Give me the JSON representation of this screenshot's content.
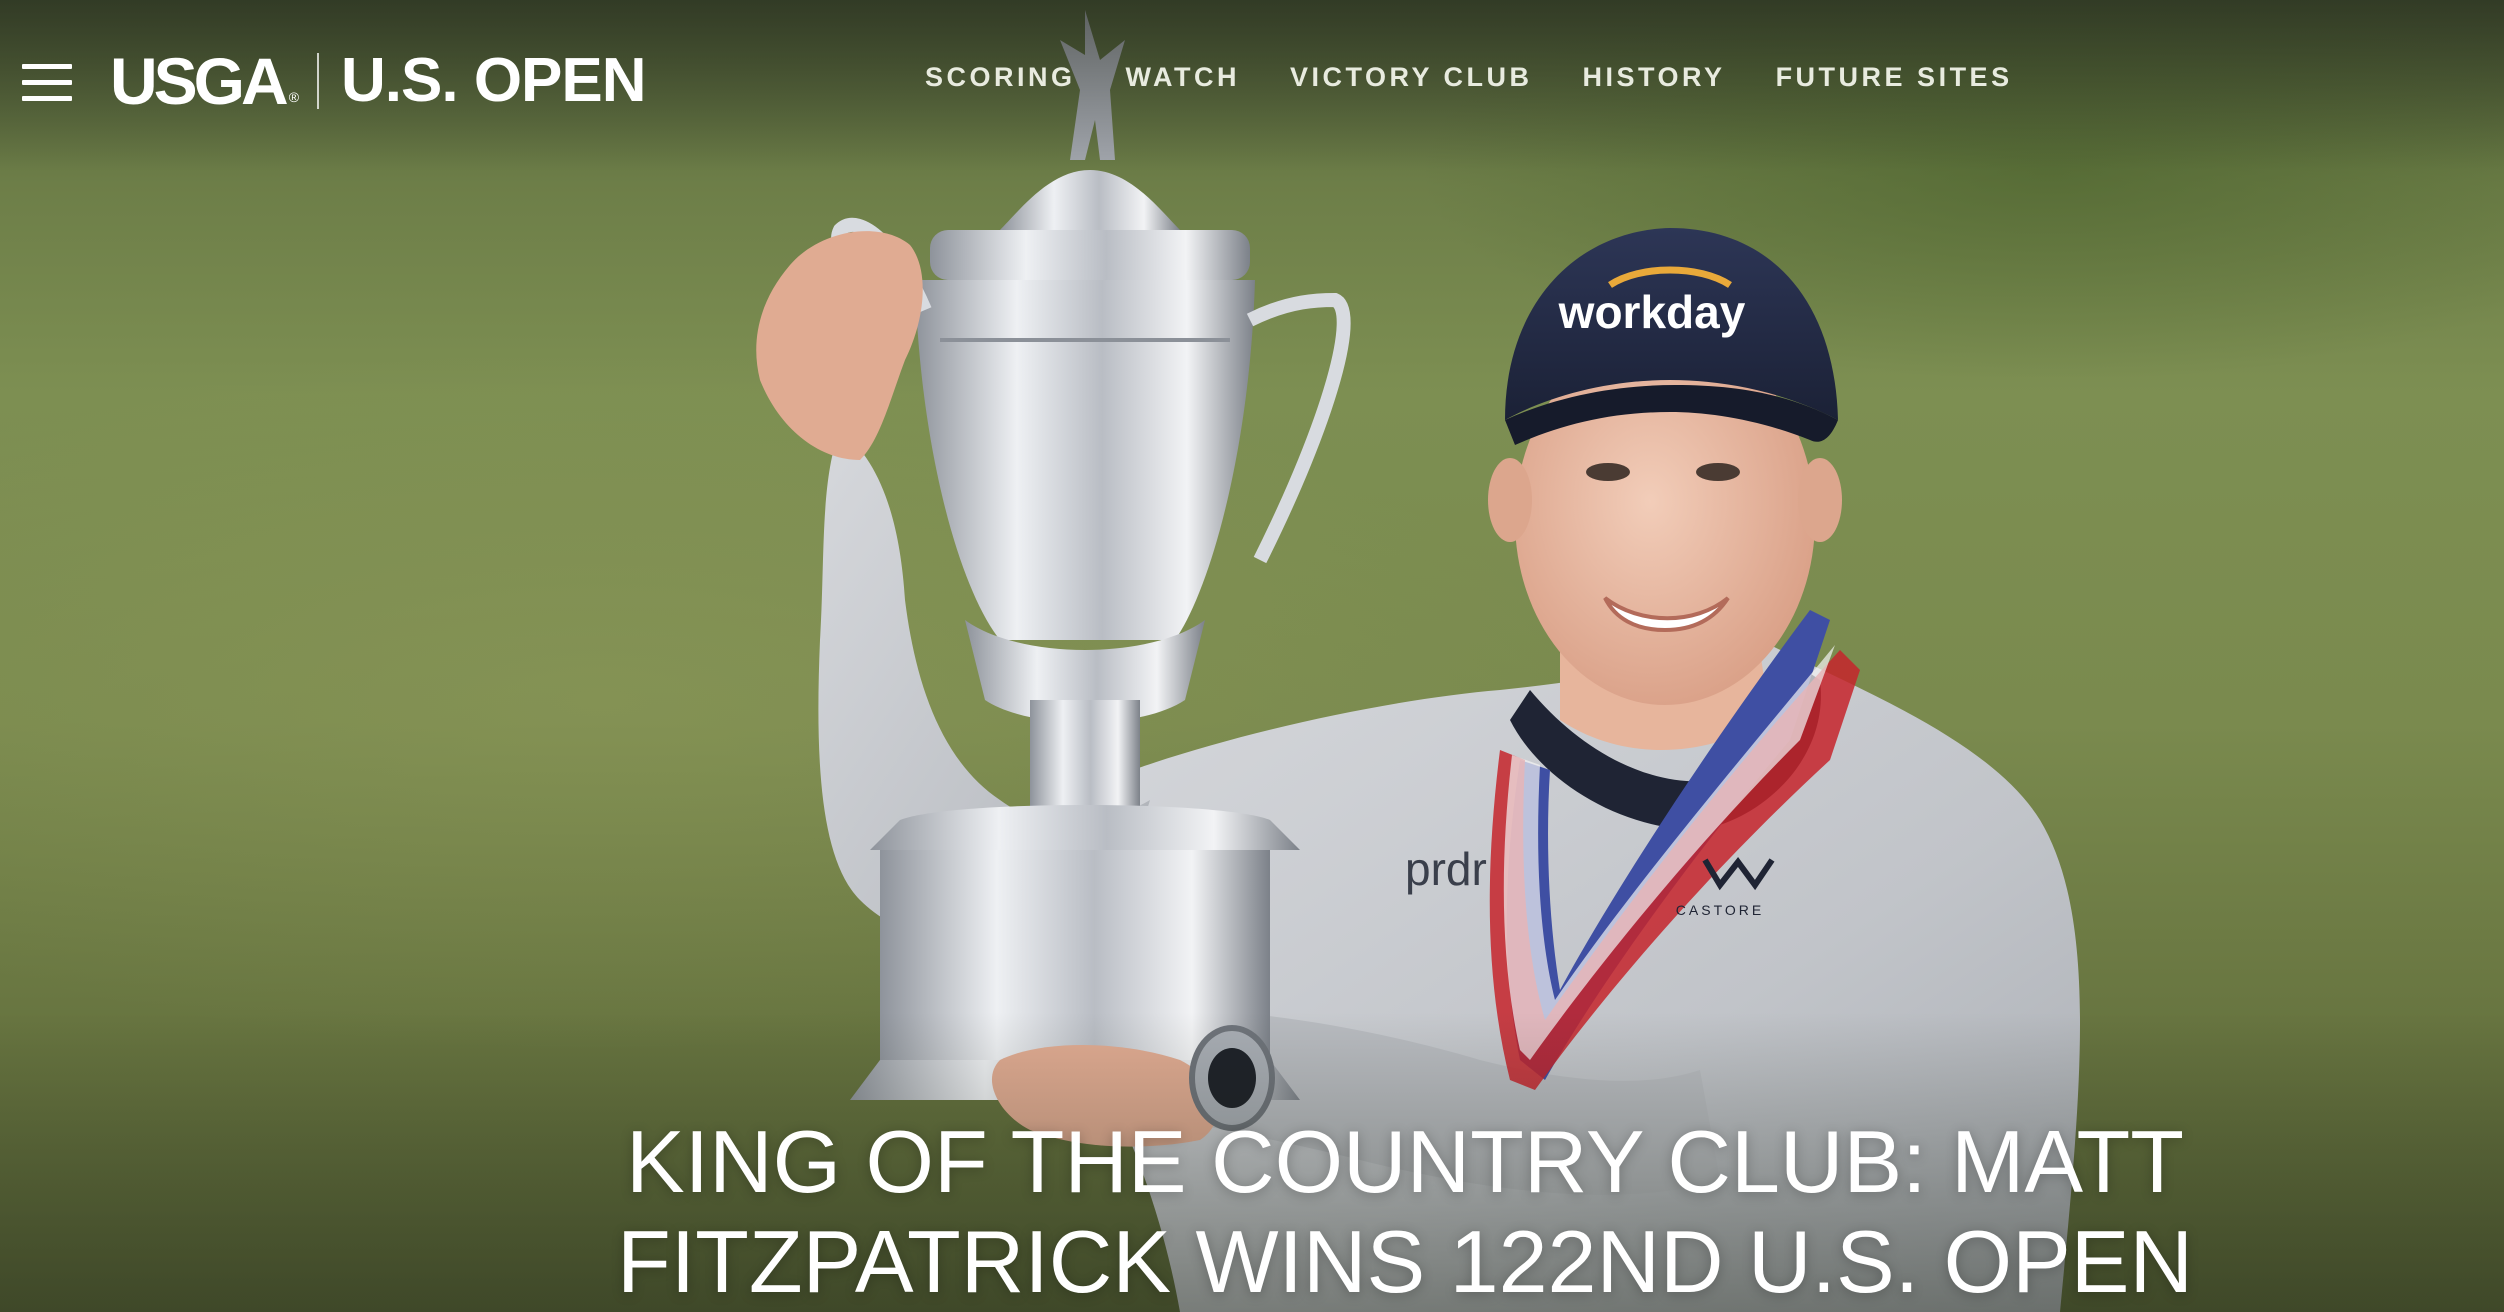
{
  "brand": {
    "usga_logo_text": "USGA",
    "usga_reg_mark": "®",
    "event_logo_text": "U.S. OPEN"
  },
  "nav": {
    "items": [
      {
        "label": "SCORING"
      },
      {
        "label": "WATCH"
      },
      {
        "label": "VICTORY CLUB"
      },
      {
        "label": "HISTORY"
      },
      {
        "label": "FUTURE SITES"
      }
    ]
  },
  "hero": {
    "headline": "KING OF THE COUNTRY CLUB: MATT FITZPATRICK WINS 122ND U.S. OPEN",
    "cap_logo_text": "workday",
    "shirt_logo_text": "CASTORE",
    "sponsor_text": "prdr"
  },
  "icons": {
    "menu": "hamburger-icon"
  },
  "colors": {
    "cap": "#232b44",
    "shirt": "#c9ccd1",
    "ribbon_blue": "#3f4fa3",
    "ribbon_red": "#c6242b",
    "trophy_silver": "#d8dbe0",
    "grass": "#7a8a4e"
  }
}
